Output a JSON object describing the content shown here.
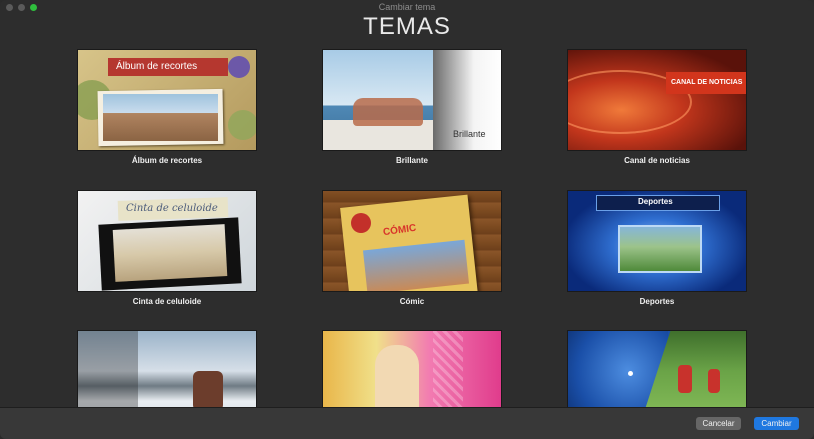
{
  "window": {
    "title": "Cambiar tema"
  },
  "heading": "TEMAS",
  "themes": [
    {
      "label": "Álbum de recortes",
      "overlay": "Álbum de recortes"
    },
    {
      "label": "Brillante",
      "overlay": "Brillante"
    },
    {
      "label": "Canal de noticias",
      "overlay": "CANAL DE NOTICIAS"
    },
    {
      "label": "Cinta de celuloide",
      "overlay": "Cinta de celuloide"
    },
    {
      "label": "Cómic",
      "overlay": "CÓMIC"
    },
    {
      "label": "Deportes",
      "overlay": "Deportes"
    },
    {
      "label": "",
      "overlay": ""
    },
    {
      "label": "",
      "overlay": ""
    },
    {
      "label": "",
      "overlay": ""
    }
  ],
  "footer": {
    "cancel_label": "Cancelar",
    "change_label": "Cambiar"
  },
  "colors": {
    "accent": "#1f78e0",
    "background": "#2d2d2d"
  }
}
